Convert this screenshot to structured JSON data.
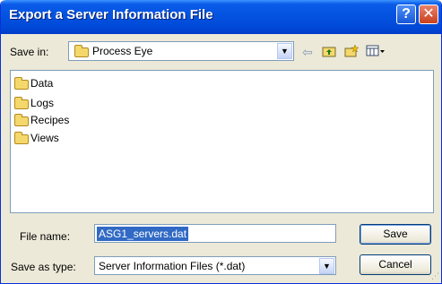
{
  "window": {
    "title": "Export a Server Information File"
  },
  "titlebar_buttons": {
    "help": "?",
    "close": "✕"
  },
  "save_in": {
    "label": "Save in:",
    "value": "Process Eye"
  },
  "toolbar_icons": [
    "back-arrow-icon",
    "up-folder-icon",
    "new-folder-icon",
    "views-menu-icon"
  ],
  "files": [
    {
      "name": "Data",
      "icon": "folder-icon"
    },
    {
      "name": "Logs",
      "icon": "folder-icon"
    },
    {
      "name": "Recipes",
      "icon": "folder-icon"
    },
    {
      "name": "Views",
      "icon": "folder-icon"
    }
  ],
  "file_name": {
    "label": "File name:",
    "value": "ASG1_servers.dat"
  },
  "save_as_type": {
    "label": "Save as type:",
    "value": "Server Information Files (*.dat)"
  },
  "buttons": {
    "save": "Save",
    "cancel": "Cancel"
  },
  "colors": {
    "titlebar": "#0453e0",
    "dialog_bg": "#ece9d8",
    "selection": "#316ac5"
  }
}
